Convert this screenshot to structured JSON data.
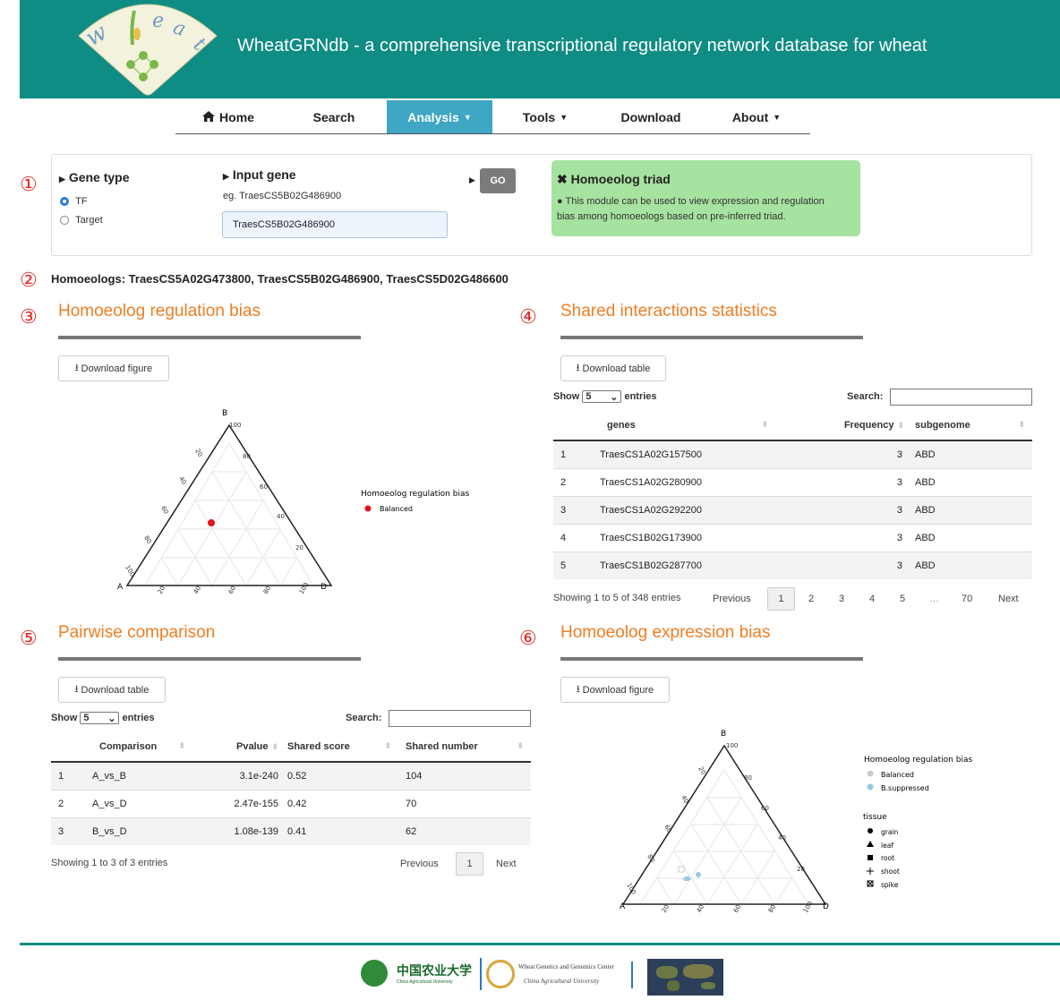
{
  "header": {
    "title": "WheatGRNdb - a comprehensive transcriptional regulatory network database for wheat",
    "logo_text": "wheat"
  },
  "nav": [
    {
      "label": "Home"
    },
    {
      "label": "Search"
    },
    {
      "label": "Analysis"
    },
    {
      "label": "Tools"
    },
    {
      "label": "Download"
    },
    {
      "label": "About"
    }
  ],
  "gene_type": {
    "label": "Gene type",
    "opt1": "TF",
    "opt2": "Target",
    "selected": "TF"
  },
  "input_gene": {
    "label": "Input gene",
    "example": "eg. TraesCS5B02G486900",
    "value": "TraesCS5B02G486900",
    "go": "GO"
  },
  "info": {
    "title": "Homoeolog triad",
    "text1": "This module can be used to view expression and regulation",
    "text2": "bias among homoeologs based on pre-inferred triad."
  },
  "markers": [
    "①",
    "②",
    "③",
    "④",
    "⑤",
    "⑥"
  ],
  "homoeologs": "Homoeologs: TraesCS5A02G473800, TraesCS5B02G486900, TraesCS5D02G486600",
  "sec3": {
    "title": "Homoeolog regulation bias",
    "button": "Download figure",
    "legend_title": "Homoeolog regulation bias",
    "legend_item": "Balanced",
    "corner_a": "A",
    "corner_b": "B",
    "corner_d": "D",
    "ticks": [
      "20",
      "40",
      "60",
      "80",
      "100"
    ]
  },
  "sec4": {
    "title": "Shared interactions statistics",
    "button": "Download table",
    "show": "Show",
    "entries": "entries",
    "length": "5",
    "search": "Search:",
    "columns": [
      "genes",
      "Frequency",
      "subgenome"
    ],
    "rows": [
      [
        "1",
        "TraesCS1A02G157500",
        "3",
        "ABD"
      ],
      [
        "2",
        "TraesCS1A02G280900",
        "3",
        "ABD"
      ],
      [
        "3",
        "TraesCS1A02G292200",
        "3",
        "ABD"
      ],
      [
        "4",
        "TraesCS1B02G173900",
        "3",
        "ABD"
      ],
      [
        "5",
        "TraesCS1B02G287700",
        "3",
        "ABD"
      ]
    ],
    "info": "Showing 1 to 5 of 348 entries",
    "pages": [
      "1",
      "2",
      "3",
      "4",
      "5",
      "…",
      "70"
    ],
    "prev": "Previous",
    "next": "Next"
  },
  "sec5": {
    "title": "Pairwise comparison",
    "button": "Download table",
    "show": "Show",
    "entries": "entries",
    "length": "5",
    "search": "Search:",
    "columns": [
      "Comparison",
      "Pvalue",
      "Shared score",
      "Shared number"
    ],
    "rows": [
      [
        "1",
        "A_vs_B",
        "3.1e-240",
        "0.52",
        "104"
      ],
      [
        "2",
        "A_vs_D",
        "2.47e-155",
        "0.42",
        "70"
      ],
      [
        "3",
        "B_vs_D",
        "1.08e-139",
        "0.41",
        "62"
      ]
    ],
    "info": "Showing 1 to 3 of 3 entries",
    "page": "1",
    "prev": "Previous",
    "next": "Next"
  },
  "sec6": {
    "title": "Homoeolog expression bias",
    "button": "Download figure",
    "legend_title": "Homoeolog regulation bias",
    "legend_items": [
      "Balanced",
      "B.suppressed"
    ],
    "tissue_title": "tissue",
    "tissues": [
      "grain",
      "leaf",
      "root",
      "shoot",
      "spike"
    ]
  },
  "colors": {
    "header": "#0f8c83",
    "accent": "#f07d22",
    "active_nav": "#3fa6c4",
    "info_bg": "#a6e2a0",
    "marker": "#e0281f"
  },
  "footer": {
    "logo1_cn": "中国农业大学",
    "logo1_en": "China Agricultural University",
    "logo2_l1": "Wheat Genetics and Genomics Center",
    "logo2_l2": "China Agricultural University"
  }
}
